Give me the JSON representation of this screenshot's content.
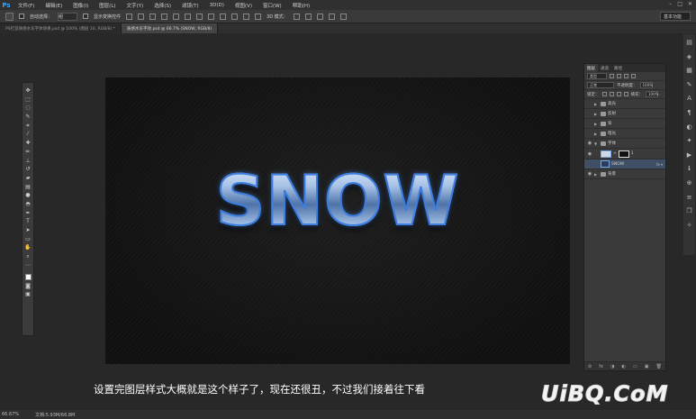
{
  "app": {
    "logo": "Ps"
  },
  "menu": [
    "文件(F)",
    "编辑(E)",
    "图像(I)",
    "图层(L)",
    "文字(Y)",
    "选择(S)",
    "滤镜(T)",
    "3D(D)",
    "视图(V)",
    "窗口(W)",
    "帮助(H)"
  ],
  "window_controls": [
    "–",
    "□",
    "✕"
  ],
  "options": {
    "auto_select_label": "自动选择：",
    "auto_select_value": "组",
    "show_transform_label": "显示变换控件",
    "mode_3d_label": "3D 模式：",
    "workspace": "基本功能"
  },
  "tabs": [
    {
      "label": "PS打造质感水东字体效果.psd @ 100% (图层 10, RGB/8) *",
      "active": false
    },
    {
      "label": "质感水东字效.psd @ 66.7% (SNOW, RGB/8)",
      "active": true
    }
  ],
  "canvas": {
    "text": "SNOW"
  },
  "panel": {
    "tabs": [
      "图层",
      "通道",
      "路径"
    ],
    "filter_label": "类型",
    "blend_mode": "正常",
    "opacity_label": "不透明度：",
    "opacity_value": "100%",
    "lock_label": "锁定：",
    "fill_label": "填充：",
    "fill_value": "100%",
    "layers": [
      {
        "name": "高光",
        "type": "group",
        "visible": false
      },
      {
        "name": "反射",
        "type": "group",
        "visible": false
      },
      {
        "name": "背",
        "type": "group",
        "visible": false
      },
      {
        "name": "暗光",
        "type": "group",
        "visible": false
      },
      {
        "name": "字体",
        "type": "group",
        "visible": true
      },
      {
        "name": "SNOW",
        "type": "text",
        "visible": true,
        "selected": true
      },
      {
        "name": "背景",
        "type": "group",
        "visible": true
      }
    ],
    "mask_value": "1",
    "bottom_icons": [
      "⊘",
      "fx",
      "◑",
      "◐",
      "▭",
      "▣",
      "🗑"
    ]
  },
  "status": {
    "zoom": "66.67%",
    "doc": "文档:5.93M/66.8M"
  },
  "caption": "设置完图层样式大概就是这个样子了，现在还很丑，不过我们接着往下看",
  "watermark": "UiBQ.CoM"
}
